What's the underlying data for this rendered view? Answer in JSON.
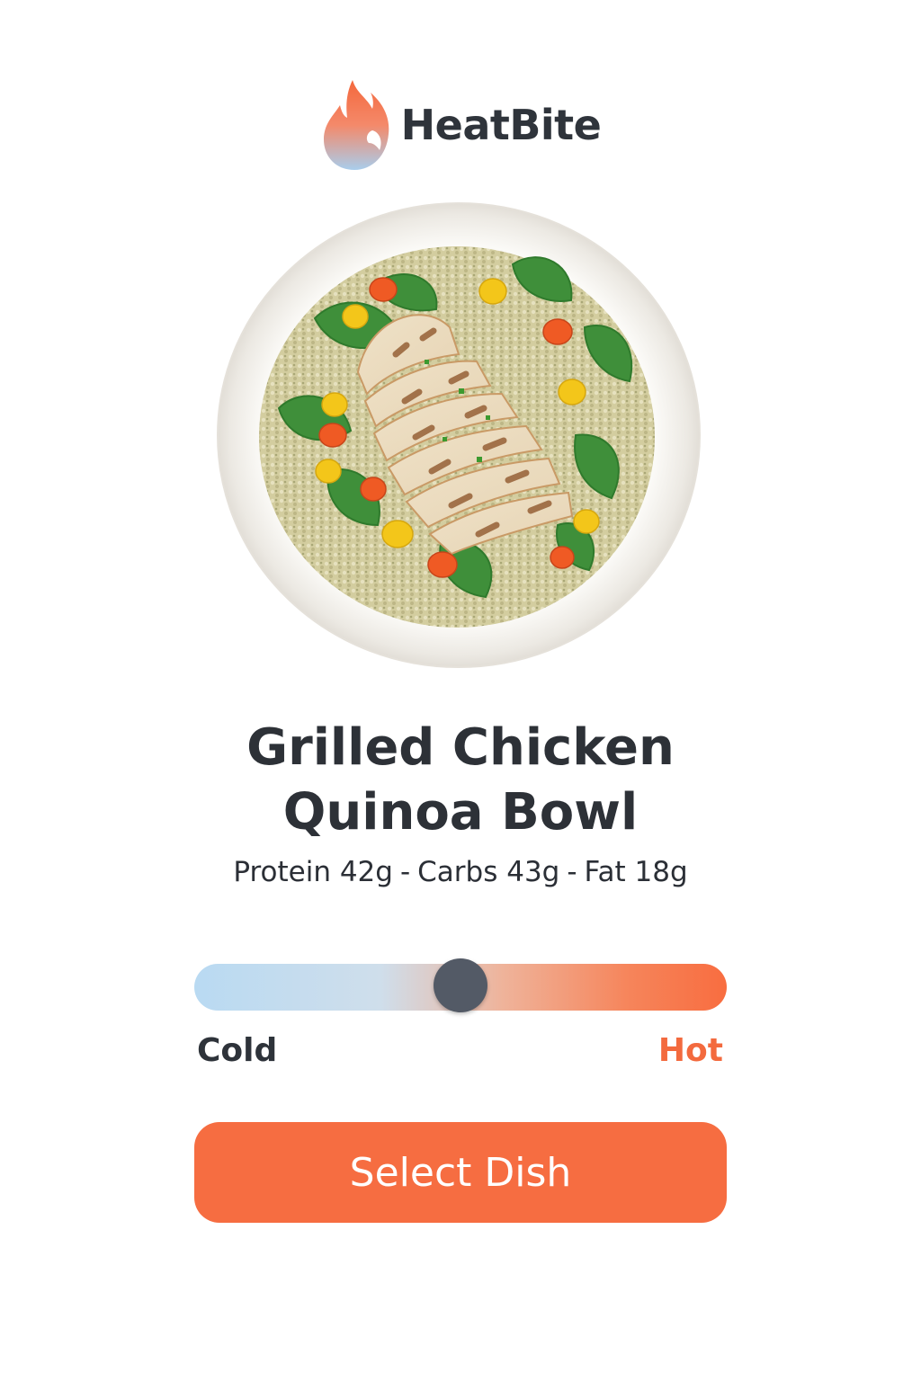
{
  "brand": {
    "name": "HeatBite",
    "logo_icon": "flame-icon"
  },
  "dish": {
    "image_icon": "chicken-quinoa-bowl-image",
    "title_line1": "Grilled Chicken",
    "title_line2": "Quinoa Bowl",
    "macros": {
      "protein": "Protein 42g",
      "separator": "-",
      "carbs": "Carbs 43g",
      "fat": "Fat 18g"
    }
  },
  "temperature": {
    "min_label": "Cold",
    "max_label": "Hot",
    "value": 0.5
  },
  "actions": {
    "select_label": "Select Dish"
  },
  "colors": {
    "accent": "#f66d41",
    "cold": "#b9daf2",
    "hot": "#f86d40",
    "thumb": "#535a66",
    "text": "#2d3137"
  }
}
